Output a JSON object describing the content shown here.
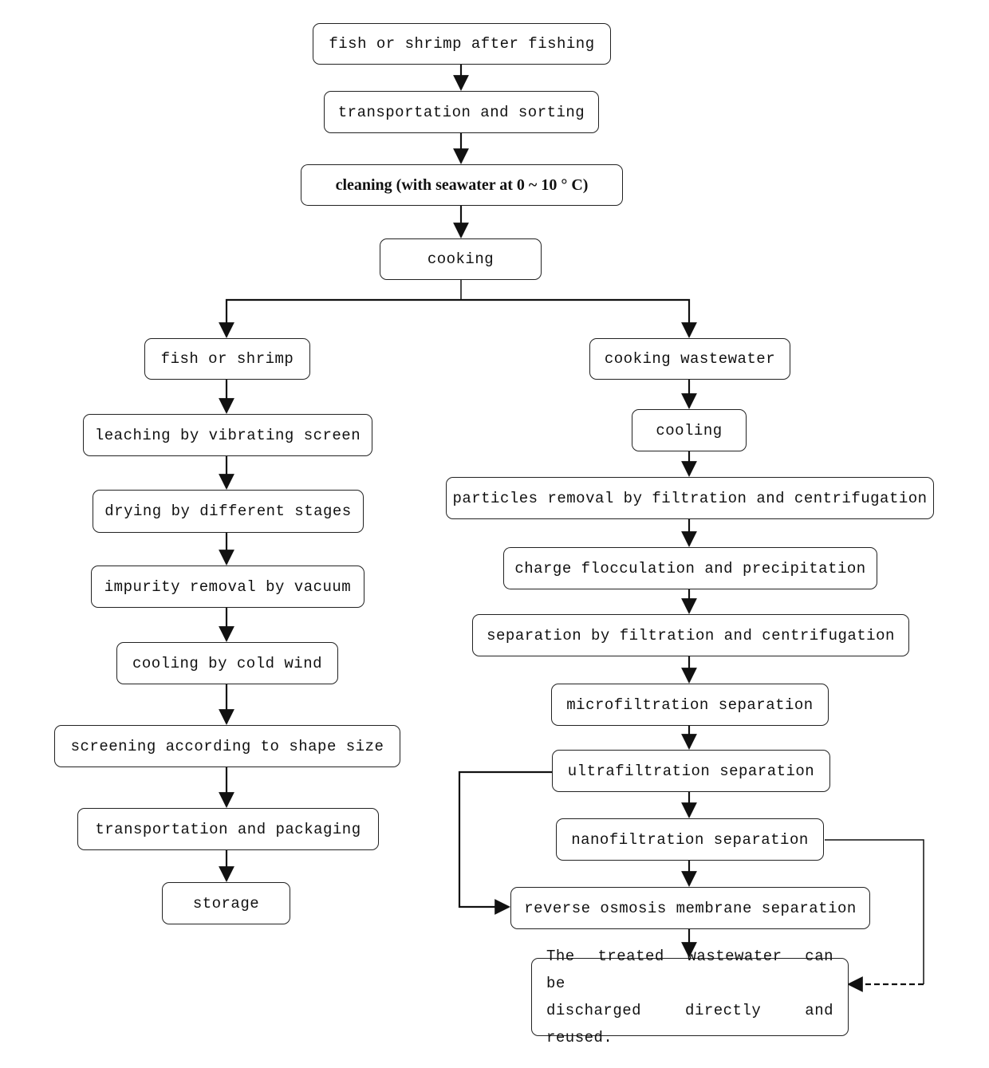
{
  "diagram": {
    "type": "flowchart",
    "main_flow": [
      {
        "id": "n1",
        "label": "fish or shrimp after fishing"
      },
      {
        "id": "n2",
        "label": "transportation and sorting"
      },
      {
        "id": "n3",
        "label": "cleaning (with seawater at 0 ~ 10 ° C)"
      },
      {
        "id": "n4",
        "label": "cooking"
      }
    ],
    "left_branch": [
      {
        "id": "l1",
        "label": "fish or shrimp"
      },
      {
        "id": "l2",
        "label": "leaching by vibrating screen"
      },
      {
        "id": "l3",
        "label": "drying by different stages"
      },
      {
        "id": "l4",
        "label": "impurity removal by vacuum"
      },
      {
        "id": "l5",
        "label": "cooling by cold wind"
      },
      {
        "id": "l6",
        "label": "screening according to shape size"
      },
      {
        "id": "l7",
        "label": "transportation and packaging"
      },
      {
        "id": "l8",
        "label": "storage"
      }
    ],
    "right_branch": [
      {
        "id": "r1",
        "label": "cooking wastewater"
      },
      {
        "id": "r2",
        "label": "cooling"
      },
      {
        "id": "r3",
        "label": "particles removal by filtration and centrifugation"
      },
      {
        "id": "r4",
        "label": "charge flocculation and precipitation"
      },
      {
        "id": "r5",
        "label": "separation by filtration and centrifugation"
      },
      {
        "id": "r6",
        "label": "microfiltration separation"
      },
      {
        "id": "r7",
        "label": "ultrafiltration separation"
      },
      {
        "id": "r8",
        "label": "nanofiltration separation"
      },
      {
        "id": "r9",
        "label": "reverse osmosis membrane separation"
      },
      {
        "id": "r10",
        "label_line1": "The treated wastewater can be",
        "label_line2": "discharged directly and reused."
      }
    ],
    "edges": [
      {
        "from": "n1",
        "to": "n2",
        "style": "solid"
      },
      {
        "from": "n2",
        "to": "n3",
        "style": "solid"
      },
      {
        "from": "n3",
        "to": "n4",
        "style": "solid"
      },
      {
        "from": "n4",
        "to": "l1",
        "style": "solid"
      },
      {
        "from": "n4",
        "to": "r1",
        "style": "solid"
      },
      {
        "from": "l1",
        "to": "l2",
        "style": "solid"
      },
      {
        "from": "l2",
        "to": "l3",
        "style": "solid"
      },
      {
        "from": "l3",
        "to": "l4",
        "style": "solid"
      },
      {
        "from": "l4",
        "to": "l5",
        "style": "solid"
      },
      {
        "from": "l5",
        "to": "l6",
        "style": "solid"
      },
      {
        "from": "l6",
        "to": "l7",
        "style": "solid"
      },
      {
        "from": "l7",
        "to": "l8",
        "style": "solid"
      },
      {
        "from": "r1",
        "to": "r2",
        "style": "solid"
      },
      {
        "from": "r2",
        "to": "r3",
        "style": "solid"
      },
      {
        "from": "r3",
        "to": "r4",
        "style": "solid"
      },
      {
        "from": "r4",
        "to": "r5",
        "style": "solid"
      },
      {
        "from": "r5",
        "to": "r6",
        "style": "solid"
      },
      {
        "from": "r6",
        "to": "r7",
        "style": "solid"
      },
      {
        "from": "r7",
        "to": "r8",
        "style": "solid"
      },
      {
        "from": "r7",
        "to": "r9",
        "style": "solid-bypass"
      },
      {
        "from": "r8",
        "to": "r9",
        "style": "solid"
      },
      {
        "from": "r8",
        "to": "r10",
        "style": "dashed-bypass"
      },
      {
        "from": "r9",
        "to": "r10",
        "style": "solid"
      }
    ]
  }
}
